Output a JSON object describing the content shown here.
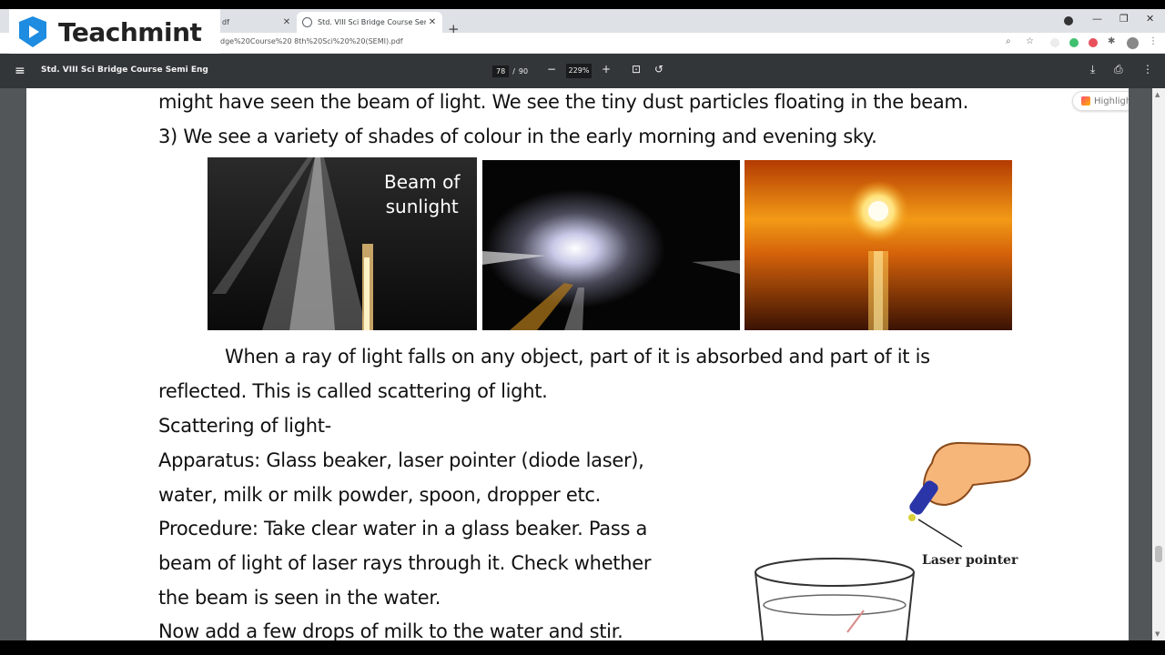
{
  "browser": {
    "tabs": [
      {
        "title": "df",
        "active": false
      },
      {
        "title": "Std. VIII Sci Bridge Course Semi",
        "active": true
      }
    ],
    "url": "dge%20Course%20 8th%20Sci%20%20(SEMI).pdf"
  },
  "logo": {
    "text": "Teachmint",
    "color": "#1e8ce0"
  },
  "pdf_toolbar": {
    "title": "Std. VIII Sci Bridge Course Semi Eng",
    "current_page": "78",
    "total_pages": "90",
    "zoom": "229%"
  },
  "page": {
    "highlight_label": "Highlight",
    "lines": {
      "l1": "might have seen the beam of light. We see the tiny dust particles floating in the beam.",
      "l2": "3) We see a variety of shades of colour in the early morning and evening sky.",
      "p1": "When a ray of light falls on any object, part of it is absorbed and part of it is",
      "p2": "reflected. This is  called scattering of light.",
      "h1": "Scattering of light-",
      "a1": "Apparatus: Glass beaker, laser pointer (diode laser),",
      "a2": "water, milk or milk powder, spoon,  dropper etc.",
      "pr1": "Procedure: Take clear water in a glass beaker. Pass a",
      "pr2": "beam of light of laser rays through it. Check whether",
      "pr3": "the beam is seen in the water.",
      "pr4": "Now add a few drops of milk to the water and stir."
    },
    "figure": {
      "beam_label_1": "Beam of",
      "beam_label_2": "sunlight",
      "laser_label": "Laser pointer"
    }
  }
}
